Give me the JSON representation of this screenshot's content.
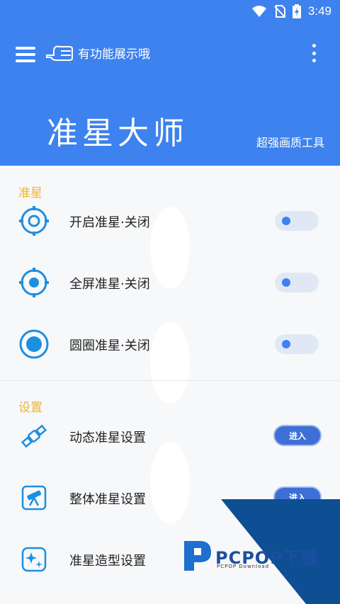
{
  "status_bar": {
    "time": "3:49"
  },
  "header": {
    "hint_text": "有功能展示哦",
    "title": "准星大师",
    "subtitle": "超强画质工具"
  },
  "sections": [
    {
      "title": "准星"
    },
    {
      "title": "设置"
    }
  ],
  "crosshair_items": [
    {
      "label": "开启准星·关闭",
      "enabled": false
    },
    {
      "label": "全屏准星·关闭",
      "enabled": false
    },
    {
      "label": "圆圈准星·关闭",
      "enabled": false
    }
  ],
  "setting_items": [
    {
      "label": "动态准星设置",
      "button": "进入"
    },
    {
      "label": "整体准星设置",
      "button": "进入"
    },
    {
      "label": "准星造型设置"
    }
  ],
  "watermark": {
    "brand": "PCPOP下载",
    "sub": "PCPOP Download"
  },
  "colors": {
    "primary": "#3d82ee",
    "accent": "#f0b429",
    "icon": "#1c8fe0"
  }
}
